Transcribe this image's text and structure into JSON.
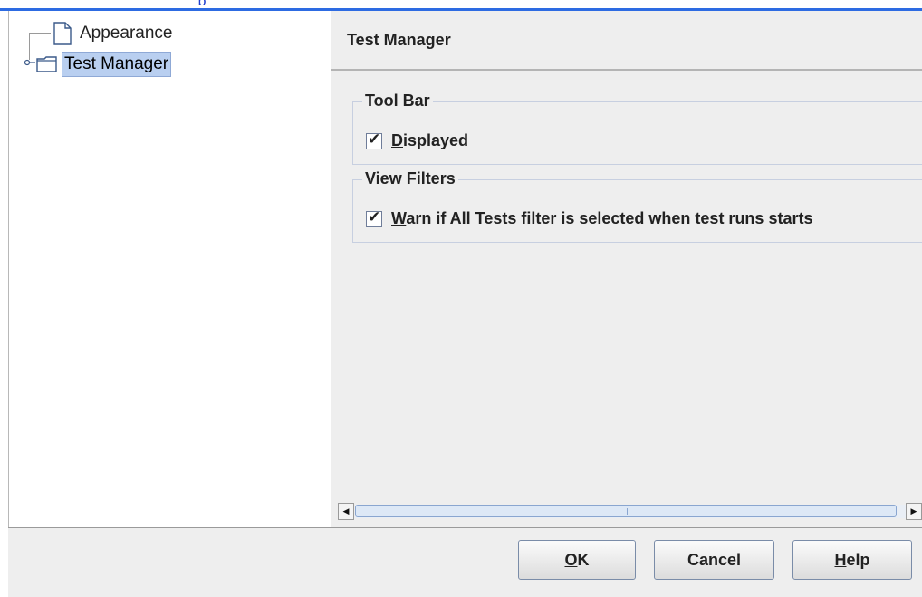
{
  "window": {
    "title_fragment": "p"
  },
  "tree": {
    "items": [
      {
        "label": "Appearance",
        "icon": "document-icon",
        "selected": false
      },
      {
        "label": "Test Manager",
        "icon": "folder-icon",
        "selected": true
      }
    ]
  },
  "panel": {
    "title": "Test Manager",
    "groups": [
      {
        "title": "Tool Bar",
        "options": [
          {
            "mnemonic": "D",
            "rest": "isplayed",
            "checked": true,
            "checkmark": "✔"
          }
        ]
      },
      {
        "title": "View Filters",
        "options": [
          {
            "mnemonic": "W",
            "rest": "arn if All Tests filter is selected when test runs starts",
            "checked": true,
            "checkmark": "✔"
          }
        ]
      }
    ]
  },
  "scrollbar": {
    "left_arrow": "◀",
    "right_arrow": "▶"
  },
  "buttons": {
    "ok": {
      "mnemonic": "O",
      "rest": "K"
    },
    "cancel": {
      "label": "Cancel"
    },
    "help": {
      "mnemonic": "H",
      "rest": "elp"
    }
  },
  "colors": {
    "accent": "#2d6be2",
    "selection": "#b9cff0",
    "panel_bg": "#eeeeee"
  }
}
